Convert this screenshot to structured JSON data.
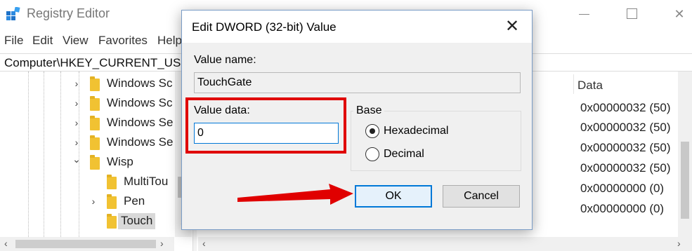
{
  "window": {
    "title": "Registry Editor",
    "minimize_glyph": "",
    "maximize_glyph": "",
    "close_glyph": "✕"
  },
  "menu": [
    "File",
    "Edit",
    "View",
    "Favorites",
    "Help"
  ],
  "address": "Computer\\HKEY_CURRENT_USER",
  "tree": [
    {
      "label": "Windows Sc",
      "expander": "›",
      "indent": 0,
      "selected": false
    },
    {
      "label": "Windows Sc",
      "expander": "›",
      "indent": 0,
      "selected": false
    },
    {
      "label": "Windows Se",
      "expander": "›",
      "indent": 0,
      "selected": false
    },
    {
      "label": "Windows Se",
      "expander": "›",
      "indent": 0,
      "selected": false
    },
    {
      "label": "Wisp",
      "expander": "⌄",
      "indent": 0,
      "selected": false
    },
    {
      "label": "MultiTou",
      "expander": "",
      "indent": 1,
      "selected": false
    },
    {
      "label": "Pen",
      "expander": "›",
      "indent": 1,
      "selected": false
    },
    {
      "label": "Touch",
      "expander": "",
      "indent": 1,
      "selected": true
    }
  ],
  "data_column": {
    "header": "Data",
    "values": [
      "0x00000032 (50)",
      "0x00000032 (50)",
      "0x00000032 (50)",
      "0x00000032 (50)",
      "0x00000000 (0)",
      "0x00000000 (0)"
    ]
  },
  "dialog": {
    "title": "Edit DWORD (32-bit) Value",
    "close_glyph": "✕",
    "value_name_label": "Value name:",
    "value_name": "TouchGate",
    "value_data_label": "Value data:",
    "value_data": "0",
    "base_label": "Base",
    "radios": [
      {
        "label": "Hexadecimal",
        "checked": true
      },
      {
        "label": "Decimal",
        "checked": false
      }
    ],
    "ok_label": "OK",
    "cancel_label": "Cancel",
    "highlight_color": "#e00000"
  },
  "scroll": {
    "left_arrow": "‹",
    "right_arrow": "›",
    "down_arrow": "⌄"
  }
}
